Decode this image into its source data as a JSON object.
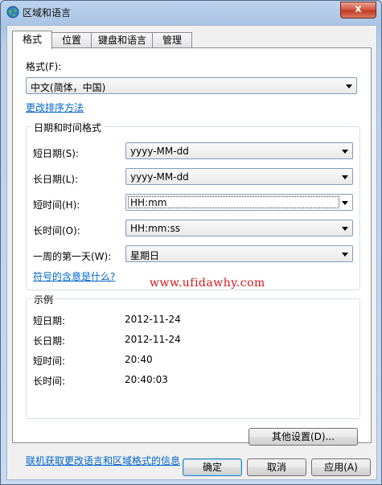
{
  "window": {
    "title": "区域和语言",
    "close_label": "x"
  },
  "tabs": [
    {
      "label": "格式"
    },
    {
      "label": "位置"
    },
    {
      "label": "键盘和语言"
    },
    {
      "label": "管理"
    }
  ],
  "format": {
    "label": "格式(F):",
    "value": "中文(简体，中国)",
    "sort_link": "更改排序方法"
  },
  "datetime": {
    "title": "日期和时间格式",
    "rows": [
      {
        "label": "短日期(S):",
        "value": "yyyy-MM-dd"
      },
      {
        "label": "长日期(L):",
        "value": "yyyy-MM-dd"
      },
      {
        "label": "短时间(H):",
        "value": "HH:mm"
      },
      {
        "label": "长时间(O):",
        "value": "HH:mm:ss"
      },
      {
        "label": "一周的第一天(W):",
        "value": "星期日"
      }
    ],
    "help_link": "符号的含意是什么?"
  },
  "watermark": "www.ufidawhy.com",
  "examples": {
    "title": "示例",
    "rows": [
      {
        "label": "短日期:",
        "value": "2012-11-24"
      },
      {
        "label": "长日期:",
        "value": "2012-11-24"
      },
      {
        "label": "短时间:",
        "value": "20:40"
      },
      {
        "label": "长时间:",
        "value": "20:40:03"
      }
    ]
  },
  "other_settings_label": "其他设置(D)...",
  "online_link": "联机获取更改语言和区域格式的信息",
  "buttons": {
    "ok": "确定",
    "cancel": "取消",
    "apply": "应用(A)"
  }
}
